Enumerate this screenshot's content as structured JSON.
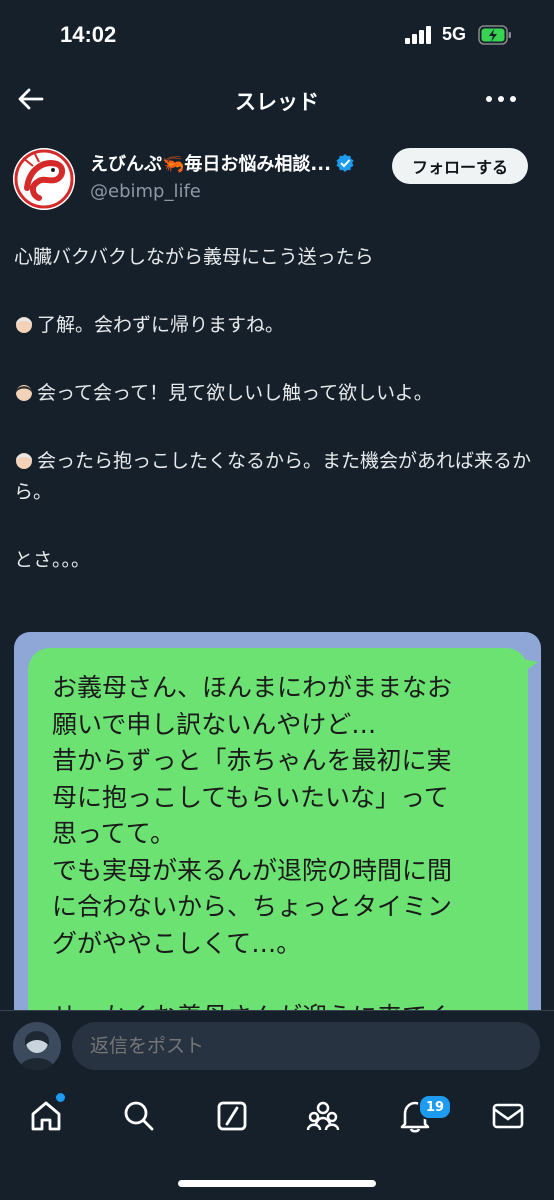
{
  "status_bar": {
    "time": "14:02",
    "network": "5G"
  },
  "header": {
    "title": "スレッド"
  },
  "author": {
    "name": "えびんぷ🦐毎日お悩み相談...",
    "handle": "@ebimp_life",
    "follow_label": "フォローする"
  },
  "post": {
    "lines": [
      "心臓バクバクしながら義母にこう送ったら",
      "了解。会わずに帰りますね。",
      "会って会って！見て欲しいし触って欲しいよ。",
      "会ったら抱っこしたくなるから。また機会があれば来るから。",
      "とさ。。。"
    ]
  },
  "image": {
    "bubble_text": "お義母さん、ほんまにわがままなお\n願いで申し訳ないんやけど…\n昔からずっと「赤ちゃんを最初に実\n母に抱っこしてもらいたいな」って\n思ってて。\nでも実母が来るんが退院の時間に間\nに合わないから、ちょっとタイミン\nグがややこしくて…。\n\nせっかくお義母さんが迎えに来てく"
  },
  "reply": {
    "placeholder": "返信をポスト"
  },
  "nav": {
    "notifications_count": "19"
  },
  "colors": {
    "background": "#15202b",
    "accent": "#1d9bf0",
    "bubble": "#6ce273",
    "image_bg": "#8ea7d6"
  }
}
